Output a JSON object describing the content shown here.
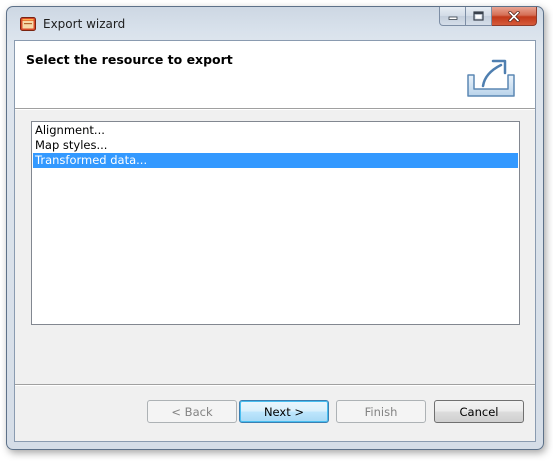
{
  "window": {
    "title": "Export wizard",
    "app_icon": "wizard-app-icon",
    "caption_buttons": {
      "minimize_icon": "minimize-icon",
      "maximize_icon": "maximize-icon",
      "close_icon": "close-icon"
    }
  },
  "header": {
    "title": "Select the resource to export",
    "icon": "export-icon"
  },
  "resource_list": {
    "items": [
      {
        "label": "Alignment...",
        "selected": false
      },
      {
        "label": "Map styles...",
        "selected": false
      },
      {
        "label": "Transformed data...",
        "selected": true
      }
    ]
  },
  "buttons": {
    "back": "< Back",
    "next": "Next >",
    "finish": "Finish",
    "cancel": "Cancel"
  },
  "colors": {
    "selection": "#3399ff",
    "close_button": "#c2391a"
  }
}
